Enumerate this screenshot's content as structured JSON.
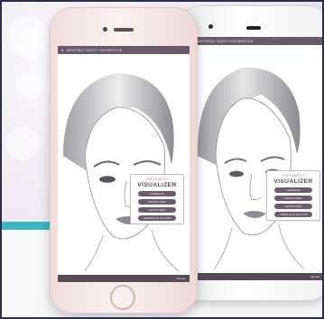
{
  "app": {
    "header_text": "IMPORTANT SAFETY INFORMATION",
    "header_icon": "caret-down-icon",
    "footer_brand": "Allergan",
    "visualizer": {
      "title_small": "TREATMENT",
      "title_large": "VISUALIZER",
      "buttons": [
        "FOREHEAD",
        "FROWN LINES",
        "CROW'S FEET",
        "UNDER EYE HOLLOWS"
      ]
    }
  },
  "colors": {
    "app_bar": "#6a5a68",
    "button": "#6e5a6c",
    "accent_line": "#3cb7c0",
    "frame_border": "#2a2d52"
  }
}
